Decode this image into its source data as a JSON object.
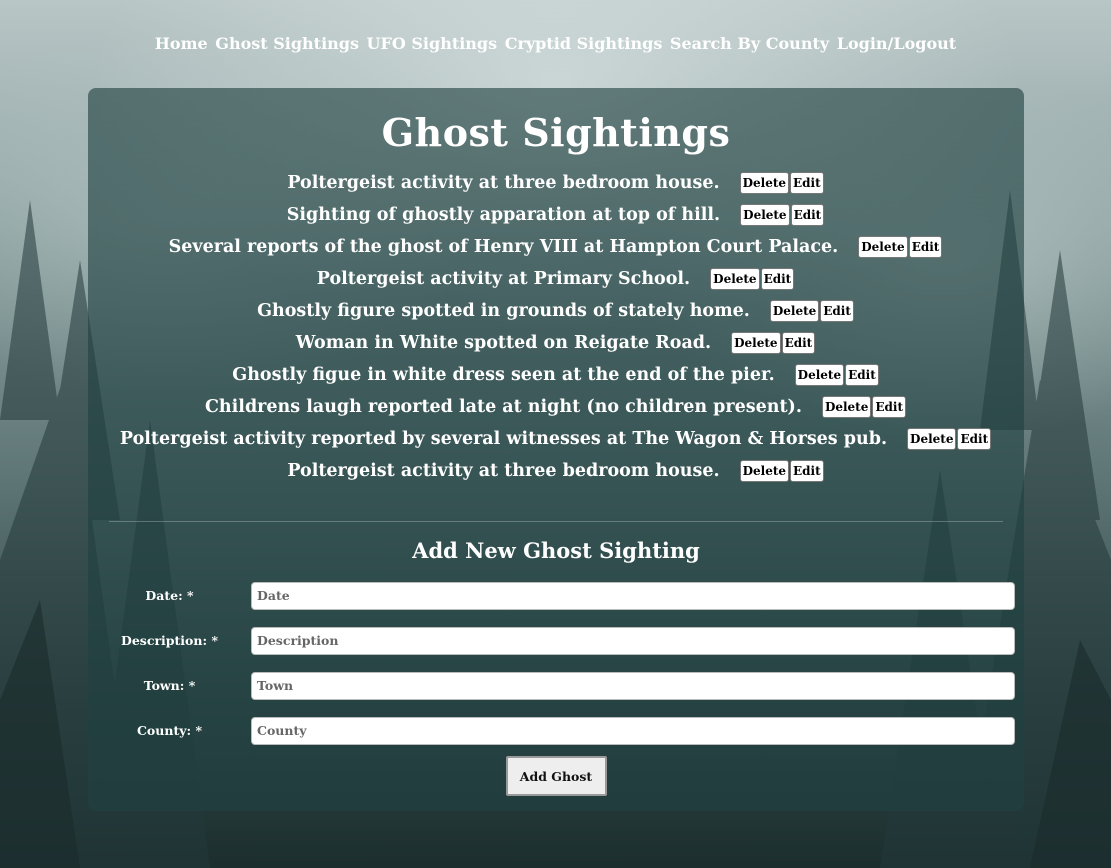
{
  "nav": {
    "home": "Home",
    "ghost": "Ghost Sightings",
    "ufo": "UFO Sightings",
    "cryptid": "Cryptid Sightings",
    "county": "Search By County",
    "login": "Login/Logout"
  },
  "page_title": "Ghost Sightings",
  "sightings": [
    {
      "text": "Poltergeist activity at three bedroom house.",
      "delete": "Delete",
      "edit": "Edit"
    },
    {
      "text": "Sighting of ghostly apparation at top of hill.",
      "delete": "Delete",
      "edit": "Edit"
    },
    {
      "text": "Several reports of the ghost of Henry VIII at Hampton Court Palace.",
      "delete": "Delete",
      "edit": "Edit"
    },
    {
      "text": "Poltergeist activity at Primary School.",
      "delete": "Delete",
      "edit": "Edit"
    },
    {
      "text": "Ghostly figure spotted in grounds of stately home.",
      "delete": "Delete",
      "edit": "Edit"
    },
    {
      "text": "Woman in White spotted on Reigate Road.",
      "delete": "Delete",
      "edit": "Edit"
    },
    {
      "text": "Ghostly figue in white dress seen at the end of the pier.",
      "delete": "Delete",
      "edit": "Edit"
    },
    {
      "text": "Childrens laugh reported late at night (no children present).",
      "delete": "Delete",
      "edit": "Edit"
    },
    {
      "text": "Poltergeist activity reported by several witnesses at The Wagon & Horses pub.",
      "delete": "Delete",
      "edit": "Edit"
    },
    {
      "text": "Poltergeist activity at three bedroom house.",
      "delete": "Delete",
      "edit": "Edit"
    }
  ],
  "form": {
    "title": "Add New Ghost Sighting",
    "date_label": "Date: *",
    "date_placeholder": "Date",
    "description_label": "Description: *",
    "description_placeholder": "Description",
    "town_label": "Town: *",
    "town_placeholder": "Town",
    "county_label": "County: *",
    "county_placeholder": "County",
    "submit": "Add Ghost"
  }
}
